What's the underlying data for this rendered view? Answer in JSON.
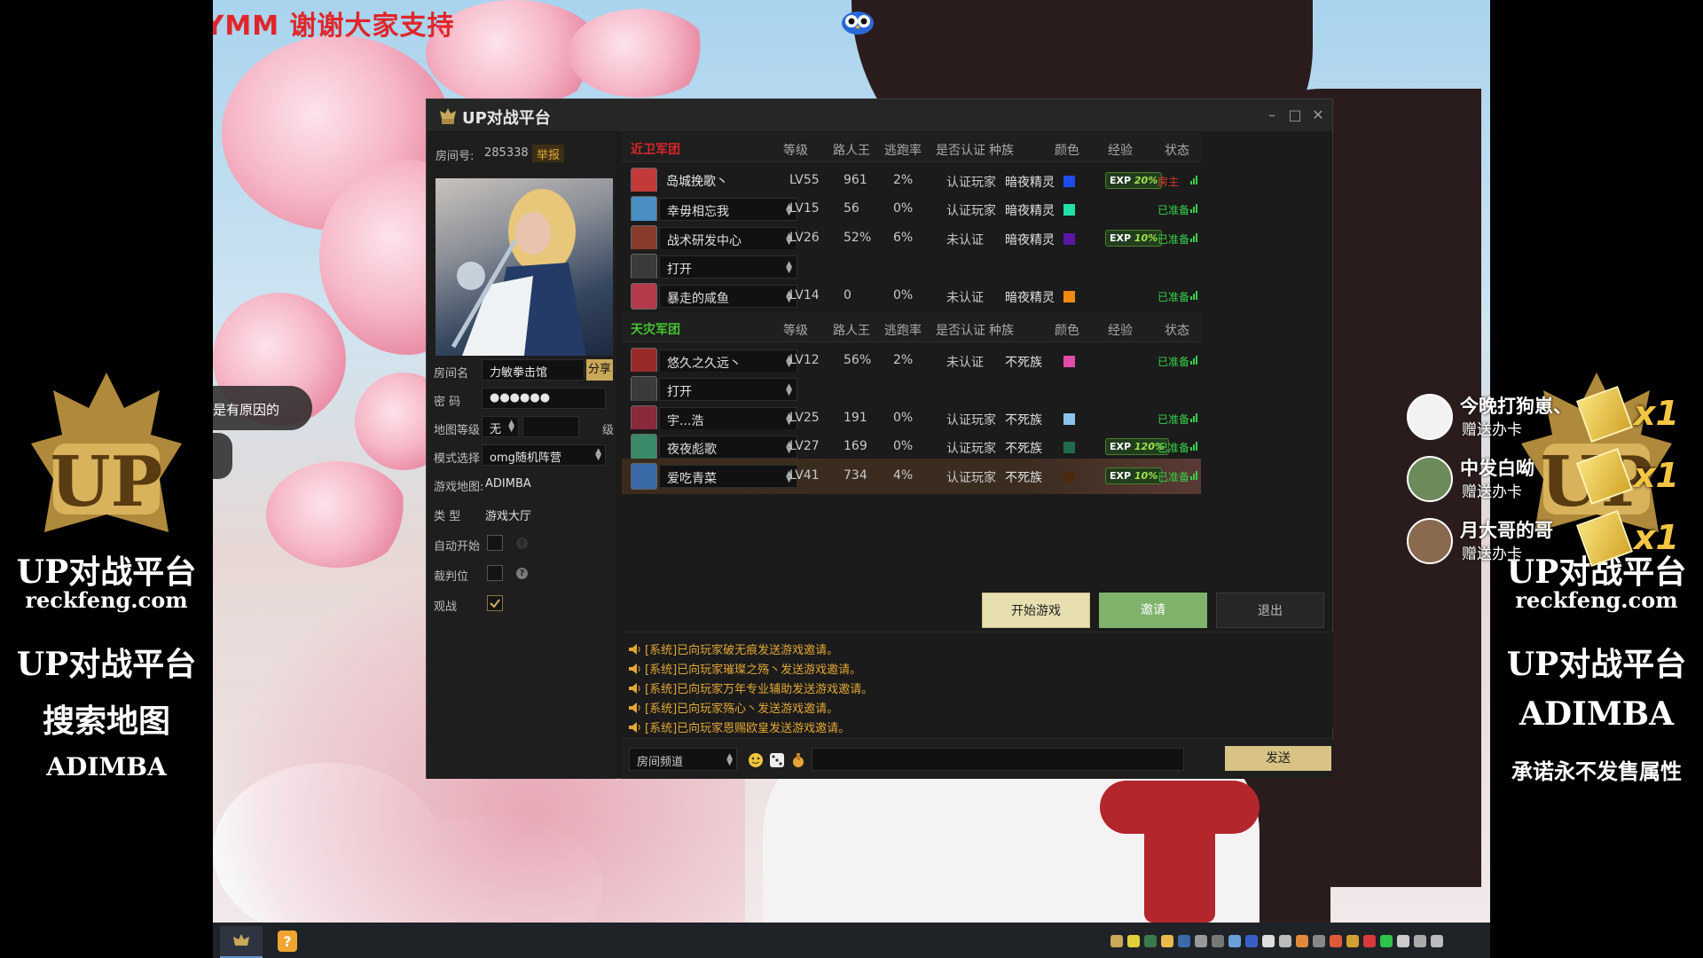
{
  "overlay": {
    "marquee": "v  ORZBABYMM 谢谢大家支持",
    "bubble_text": "是有原因的"
  },
  "side_left": {
    "brand_en": "UP对战平台",
    "site": "reckfeng.com",
    "line1": "UP对战平台",
    "line2": "搜索地图",
    "line3": "ADIMBA"
  },
  "side_right": {
    "brand_en": "UP对战平台",
    "site": "reckfeng.com",
    "line1": "UP对战平台",
    "line2": "ADIMBA",
    "line3": "承诺永不发售属性"
  },
  "gifts": [
    {
      "name": "今晚打狗崽、",
      "action": "赠送办卡",
      "count": "x1"
    },
    {
      "name": "中发白呦",
      "action": "赠送办卡",
      "count": "x1"
    },
    {
      "name": "月大哥的哥",
      "action": "赠送办卡",
      "count": "x1"
    }
  ],
  "window": {
    "title": "UP对战平台",
    "room_label": "房间号:",
    "room_number": "285338",
    "report": "举报",
    "room_name_label": "房间名",
    "room_name": "力敏拳击馆",
    "share": "分享",
    "password_label": "密    码",
    "password": "●●●●●●",
    "map_level_label": "地图等级",
    "map_level": "无",
    "level_unit": "级",
    "mode_label": "模式选择",
    "mode": "omg随机阵营",
    "game_map_label": "游戏地图:",
    "game_map": "ADIMBA",
    "type_label": "类    型",
    "type": "游戏大厅",
    "auto_start_label": "自动开始",
    "referee_label": "裁判位",
    "spectate_label": "观战"
  },
  "table": {
    "headers": [
      "等级",
      "路人王",
      "逃跑率",
      "是否认证",
      "种族",
      "颜色",
      "经验",
      "状态"
    ],
    "team1": {
      "name": "近卫军团",
      "color": "#d7262b",
      "players": [
        {
          "name": "岛城挽歌丶",
          "level": "LV55",
          "king": "961",
          "escape": "2%",
          "cert": "认证玩家",
          "race": "暗夜精灵",
          "color": "#1f4ce8",
          "exp": "20%",
          "status": "房主",
          "status_color": "#d8352a",
          "slot": false
        },
        {
          "name": "幸毋相忘我",
          "level": "LV15",
          "king": "56",
          "escape": "0%",
          "cert": "认证玩家",
          "race": "暗夜精灵",
          "color": "#22e0a8",
          "exp": "",
          "status": "已准备",
          "status_color": "#35d24a",
          "slot": true
        },
        {
          "name": "战术研发中心",
          "level": "LV26",
          "king": "52%",
          "escape": "6%",
          "cert": "未认证",
          "race": "暗夜精灵",
          "color": "#5a16a8",
          "exp": "10%",
          "status": "已准备",
          "status_color": "#35d24a",
          "slot": true
        },
        {
          "name": "打开",
          "level": "",
          "king": "",
          "escape": "",
          "cert": "",
          "race": "",
          "color": "",
          "exp": "",
          "status": "",
          "status_color": "",
          "slot": true,
          "empty": true
        },
        {
          "name": "暴走的咸鱼",
          "level": "LV14",
          "king": "0",
          "escape": "0%",
          "cert": "未认证",
          "race": "暗夜精灵",
          "color": "#f28a12",
          "exp": "",
          "status": "已准备",
          "status_color": "#35d24a",
          "slot": true
        }
      ]
    },
    "team2": {
      "name": "天灾军团",
      "color": "#45c42f",
      "players": [
        {
          "name": "悠久之久远丶",
          "level": "LV12",
          "king": "56%",
          "escape": "2%",
          "cert": "未认证",
          "race": "不死族",
          "color": "#e24ba8",
          "exp": "",
          "status": "已准备",
          "status_color": "#35d24a",
          "slot": true
        },
        {
          "name": "打开",
          "level": "",
          "king": "",
          "escape": "",
          "cert": "",
          "race": "",
          "color": "",
          "exp": "",
          "status": "",
          "status_color": "",
          "slot": true,
          "empty": true
        },
        {
          "name": "宇...浩",
          "level": "LV25",
          "king": "191",
          "escape": "0%",
          "cert": "认证玩家",
          "race": "不死族",
          "color": "#8cc3ea",
          "exp": "",
          "status": "已准备",
          "status_color": "#35d24a",
          "slot": true
        },
        {
          "name": "夜夜彪歌",
          "level": "LV27",
          "king": "169",
          "escape": "0%",
          "cert": "认证玩家",
          "race": "不死族",
          "color": "#1f6b4c",
          "exp": "120%",
          "status": "已准备",
          "status_color": "#35d24a",
          "slot": true
        },
        {
          "name": "爱吃青菜",
          "level": "LV41",
          "king": "734",
          "escape": "4%",
          "cert": "认证玩家",
          "race": "不死族",
          "color": "#4a2b10",
          "exp": "10%",
          "status": "已准备",
          "status_color": "#35d24a",
          "slot": true,
          "highlight": true
        }
      ]
    }
  },
  "buttons": {
    "start": "开始游戏",
    "invite": "邀请",
    "exit": "退出"
  },
  "log": [
    "[系统]已向玩家破无痕发送游戏邀请。",
    "[系统]已向玩家璀璨之殇丶发送游戏邀请。",
    "[系统]已向玩家万年专业辅助发送游戏邀请。",
    "[系统]已向玩家殇心丶发送游戏邀请。",
    "[系统]已向玩家恩赐欧皇发送游戏邀请。"
  ],
  "chat": {
    "channel": "房间频道",
    "send": "发送"
  }
}
